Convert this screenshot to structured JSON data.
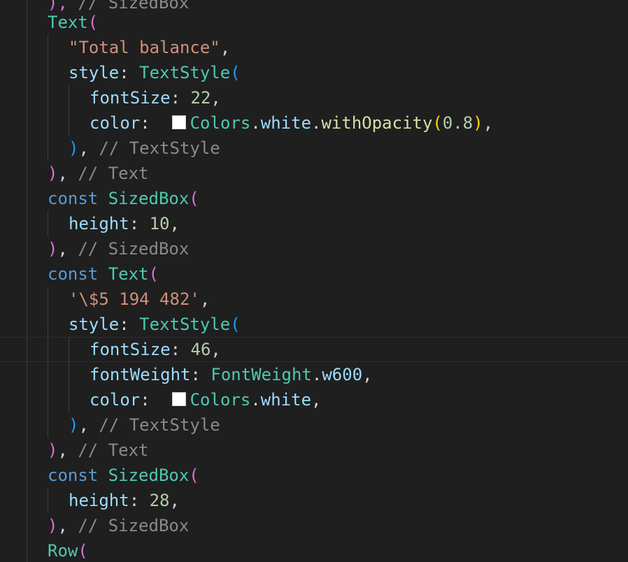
{
  "editor": {
    "lines": [
      {
        "tokens": [
          {
            "t": "), ",
            "c": "br1"
          },
          {
            "t": "// SizedBox",
            "c": "tok-cmt"
          }
        ]
      },
      {
        "tokens": [
          {
            "t": "Text",
            "c": "tok-class"
          },
          {
            "t": "(",
            "c": "br1"
          }
        ]
      },
      {
        "tokens": [
          {
            "t": "\"Total balance\"",
            "c": "tok-str"
          },
          {
            "t": ",",
            "c": "tok-punc"
          }
        ]
      },
      {
        "tokens": [
          {
            "t": "style",
            "c": "tok-prop"
          },
          {
            "t": ": ",
            "c": "tok-punc"
          },
          {
            "t": "TextStyle",
            "c": "tok-class"
          },
          {
            "t": "(",
            "c": "br2"
          }
        ]
      },
      {
        "tokens": [
          {
            "t": "fontSize",
            "c": "tok-prop"
          },
          {
            "t": ": ",
            "c": "tok-punc"
          },
          {
            "t": "22",
            "c": "tok-num"
          },
          {
            "t": ",",
            "c": "tok-punc"
          }
        ]
      },
      {
        "tokens": [
          {
            "t": "color",
            "c": "tok-prop"
          },
          {
            "t": ":  ",
            "c": "tok-punc"
          },
          {
            "t": "",
            "c": "swatch"
          },
          {
            "t": "Colors",
            "c": "tok-class"
          },
          {
            "t": ".",
            "c": "tok-punc"
          },
          {
            "t": "white",
            "c": "tok-prop"
          },
          {
            "t": ".",
            "c": "tok-punc"
          },
          {
            "t": "withOpacity",
            "c": "tok-fn"
          },
          {
            "t": "(",
            "c": "br3"
          },
          {
            "t": "0.8",
            "c": "tok-num"
          },
          {
            "t": ")",
            "c": "br3"
          },
          {
            "t": ",",
            "c": "tok-punc"
          }
        ]
      },
      {
        "tokens": [
          {
            "t": ")",
            "c": "br2"
          },
          {
            "t": ", ",
            "c": "tok-punc"
          },
          {
            "t": "// TextStyle",
            "c": "tok-cmt"
          }
        ]
      },
      {
        "tokens": [
          {
            "t": ")",
            "c": "br1"
          },
          {
            "t": ", ",
            "c": "tok-punc"
          },
          {
            "t": "// Text",
            "c": "tok-cmt"
          }
        ]
      },
      {
        "tokens": [
          {
            "t": "const ",
            "c": "tok-kw"
          },
          {
            "t": "SizedBox",
            "c": "tok-class"
          },
          {
            "t": "(",
            "c": "br1"
          }
        ]
      },
      {
        "tokens": [
          {
            "t": "height",
            "c": "tok-prop"
          },
          {
            "t": ": ",
            "c": "tok-punc"
          },
          {
            "t": "10",
            "c": "tok-num"
          },
          {
            "t": ",",
            "c": "tok-punc"
          }
        ]
      },
      {
        "tokens": [
          {
            "t": ")",
            "c": "br1"
          },
          {
            "t": ", ",
            "c": "tok-punc"
          },
          {
            "t": "// SizedBox",
            "c": "tok-cmt"
          }
        ]
      },
      {
        "tokens": [
          {
            "t": "const ",
            "c": "tok-kw"
          },
          {
            "t": "Text",
            "c": "tok-class"
          },
          {
            "t": "(",
            "c": "br1"
          }
        ]
      },
      {
        "tokens": [
          {
            "t": "'\\$5 194 482'",
            "c": "tok-str"
          },
          {
            "t": ",",
            "c": "tok-punc"
          }
        ]
      },
      {
        "tokens": [
          {
            "t": "style",
            "c": "tok-prop"
          },
          {
            "t": ": ",
            "c": "tok-punc"
          },
          {
            "t": "TextStyle",
            "c": "tok-class"
          },
          {
            "t": "(",
            "c": "br2"
          }
        ]
      },
      {
        "tokens": [
          {
            "t": "fontSize",
            "c": "tok-prop"
          },
          {
            "t": ": ",
            "c": "tok-punc"
          },
          {
            "t": "46",
            "c": "tok-num"
          },
          {
            "t": ",",
            "c": "tok-punc"
          }
        ]
      },
      {
        "tokens": [
          {
            "t": "fontWeight",
            "c": "tok-prop"
          },
          {
            "t": ": ",
            "c": "tok-punc"
          },
          {
            "t": "FontWeight",
            "c": "tok-class"
          },
          {
            "t": ".",
            "c": "tok-punc"
          },
          {
            "t": "w600",
            "c": "tok-prop"
          },
          {
            "t": ",",
            "c": "tok-punc"
          }
        ]
      },
      {
        "tokens": [
          {
            "t": "color",
            "c": "tok-prop"
          },
          {
            "t": ":  ",
            "c": "tok-punc"
          },
          {
            "t": "",
            "c": "swatch"
          },
          {
            "t": "Colors",
            "c": "tok-class"
          },
          {
            "t": ".",
            "c": "tok-punc"
          },
          {
            "t": "white",
            "c": "tok-prop"
          },
          {
            "t": ",",
            "c": "tok-punc"
          }
        ]
      },
      {
        "tokens": [
          {
            "t": ")",
            "c": "br2"
          },
          {
            "t": ", ",
            "c": "tok-punc"
          },
          {
            "t": "// TextStyle",
            "c": "tok-cmt"
          }
        ]
      },
      {
        "tokens": [
          {
            "t": ")",
            "c": "br1"
          },
          {
            "t": ", ",
            "c": "tok-punc"
          },
          {
            "t": "// Text",
            "c": "tok-cmt"
          }
        ]
      },
      {
        "tokens": [
          {
            "t": "const ",
            "c": "tok-kw"
          },
          {
            "t": "SizedBox",
            "c": "tok-class"
          },
          {
            "t": "(",
            "c": "br1"
          }
        ]
      },
      {
        "tokens": [
          {
            "t": "height",
            "c": "tok-prop"
          },
          {
            "t": ": ",
            "c": "tok-punc"
          },
          {
            "t": "28",
            "c": "tok-num"
          },
          {
            "t": ",",
            "c": "tok-punc"
          }
        ]
      },
      {
        "tokens": [
          {
            "t": ")",
            "c": "br1"
          },
          {
            "t": ", ",
            "c": "tok-punc"
          },
          {
            "t": "// SizedBox",
            "c": "tok-cmt"
          }
        ]
      },
      {
        "tokens": [
          {
            "t": "Row",
            "c": "tok-class"
          },
          {
            "t": "(",
            "c": "br1"
          }
        ]
      }
    ]
  },
  "colors": {
    "background": "#1f1f1f",
    "class": "#4ec9b0",
    "keyword": "#569cd6",
    "property": "#9cdcfe",
    "string": "#ce9178",
    "number": "#b5cea8",
    "function": "#dcdcaa",
    "comment": "#8a8a8a",
    "bracket_level1": "#da70d6",
    "bracket_level2": "#179fff",
    "bracket_level3": "#ffd700",
    "color_swatch": "#ffffff"
  }
}
